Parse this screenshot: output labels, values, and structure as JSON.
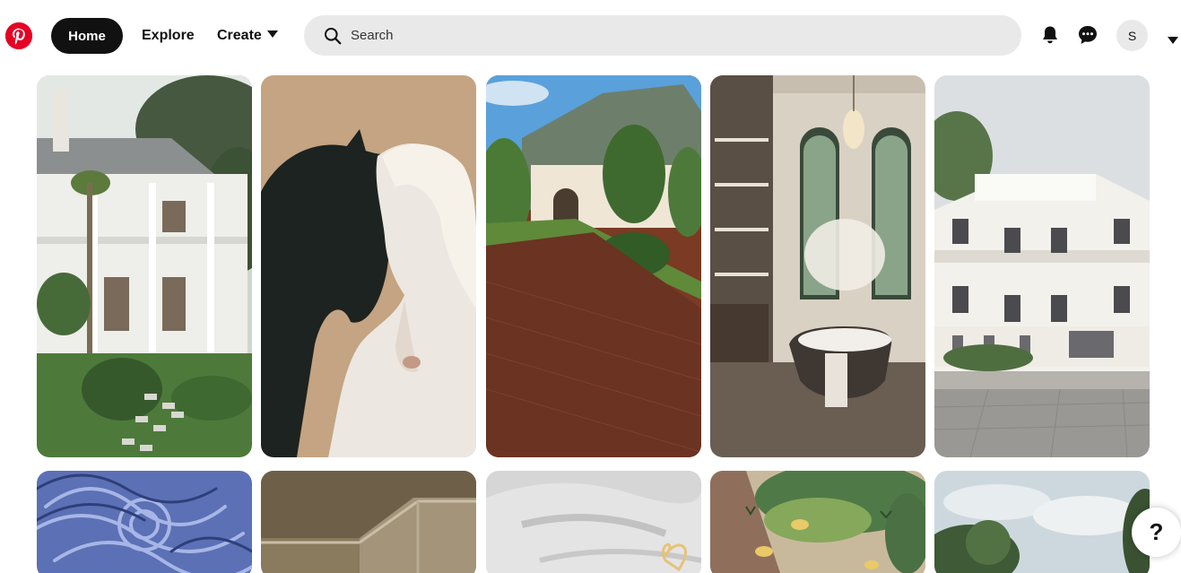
{
  "header": {
    "logo_icon": "pinterest-logo-icon",
    "brand_color": "#e60023",
    "nav": {
      "home_label": "Home",
      "explore_label": "Explore",
      "create_label": "Create"
    },
    "search": {
      "placeholder": "Search",
      "icon": "search-icon"
    },
    "notifications_icon": "bell-icon",
    "messages_icon": "chat-bubble-icon",
    "avatar_initial": "S",
    "account_menu_icon": "chevron-down-icon"
  },
  "pins": [
    {
      "subject": "white colonial house with porches and palm trees",
      "row": 1
    },
    {
      "subject": "black horse and white horse nuzzling",
      "row": 1
    },
    {
      "subject": "french chateau style house with brick driveway",
      "row": 1
    },
    {
      "subject": "luxury bathroom with freestanding bathtub and tall arched windows",
      "row": 1
    },
    {
      "subject": "white neoclassical villa",
      "row": 1
    },
    {
      "subject": "blue swirling painted texture",
      "row": 2
    },
    {
      "subject": "ceiling crown molding corner",
      "row": 2
    },
    {
      "subject": "white fabric with small heart",
      "row": 2
    },
    {
      "subject": "illustrated green bush and path",
      "row": 2
    },
    {
      "subject": "sky with clouds and trees",
      "row": 2
    }
  ],
  "help_button_label": "?"
}
